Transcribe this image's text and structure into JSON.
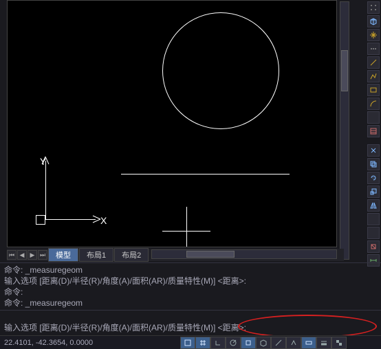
{
  "tabs": {
    "nav_first": "⏮",
    "nav_prev": "◀",
    "nav_next": "▶",
    "nav_last": "⏭",
    "items": [
      {
        "label": "模型",
        "active": true
      },
      {
        "label": "布局1",
        "active": false
      },
      {
        "label": "布局2",
        "active": false
      }
    ]
  },
  "ucs": {
    "x_label": "X",
    "y_label": "Y"
  },
  "command_history": {
    "line1_prefix": "命令: ",
    "line1_cmd": "_measuregeom",
    "line2_prompt_label": "输入选项 [距离(D)/半径(R)/角度(A)/面积(AR)/质量特性(M)] <距离>:",
    "line3_prefix": "命令:",
    "line4_prefix": "命令: ",
    "line4_cmd": "_measuregeom"
  },
  "command_input_prompt": "输入选项 [距离(D)/半径(R)/角度(A)/面积(AR)/质量特性(M)] <距离>: ",
  "command_input_value": "",
  "status": {
    "coords": "22.4101, -42.3654, 0.0000"
  }
}
